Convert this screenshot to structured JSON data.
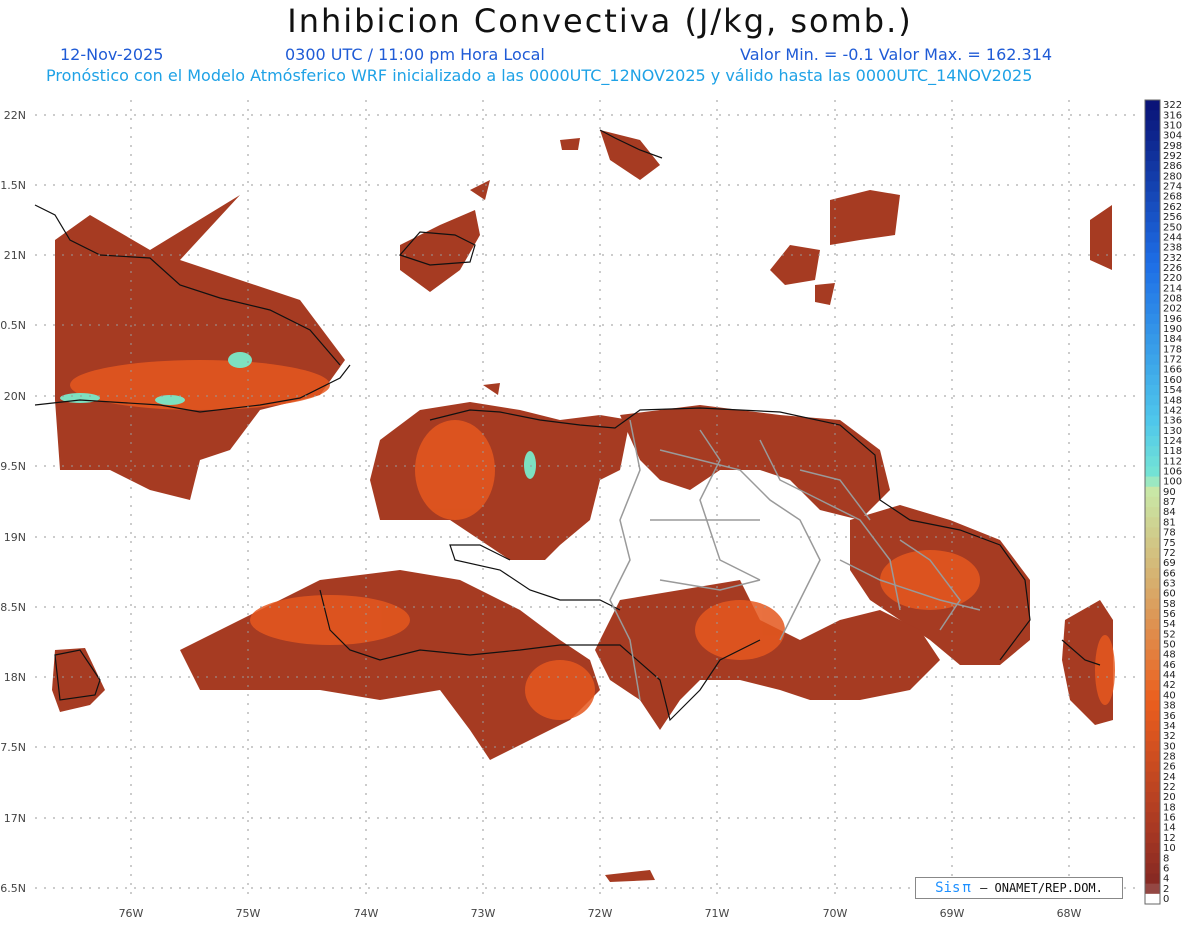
{
  "header": {
    "title": "Inhibicion Convectiva (J/kg, somb.)",
    "date": "12-Nov-2025",
    "time": "0300 UTC / 11:00 pm Hora Local",
    "minmax": "Valor Min. = -0.1  Valor Max. = 162.314",
    "model_info": "Pronóstico con el Modelo Atmósferico WRF inicializado a las 0000UTC_12NOV2025 y válido hasta las  0000UTC_14NOV2025"
  },
  "axes": {
    "lat_labels": [
      "22N",
      "1.5N",
      "21N",
      "0.5N",
      "20N",
      "9.5N",
      "19N",
      "8.5N",
      "18N",
      "7.5N",
      "17N",
      "6.5N"
    ],
    "lon_labels": [
      "76W",
      "75W",
      "74W",
      "73W",
      "72W",
      "71W",
      "70W",
      "69W",
      "68W"
    ]
  },
  "colorbar": {
    "labels": [
      "322",
      "316",
      "310",
      "304",
      "298",
      "292",
      "286",
      "280",
      "274",
      "268",
      "262",
      "256",
      "250",
      "244",
      "238",
      "232",
      "226",
      "220",
      "214",
      "208",
      "202",
      "196",
      "190",
      "184",
      "178",
      "172",
      "166",
      "160",
      "154",
      "148",
      "142",
      "136",
      "130",
      "124",
      "118",
      "112",
      "106",
      "100",
      "90",
      "87",
      "84",
      "81",
      "78",
      "75",
      "72",
      "69",
      "66",
      "63",
      "60",
      "58",
      "56",
      "54",
      "52",
      "50",
      "48",
      "46",
      "44",
      "42",
      "40",
      "38",
      "36",
      "34",
      "32",
      "30",
      "28",
      "26",
      "24",
      "22",
      "20",
      "18",
      "16",
      "14",
      "12",
      "10",
      "8",
      "6",
      "4",
      "2",
      "0"
    ]
  },
  "credit": {
    "brand_prefix": "Sis",
    "brand_symbol": "π",
    "text": "– ONAMET/REP.DOM."
  }
}
